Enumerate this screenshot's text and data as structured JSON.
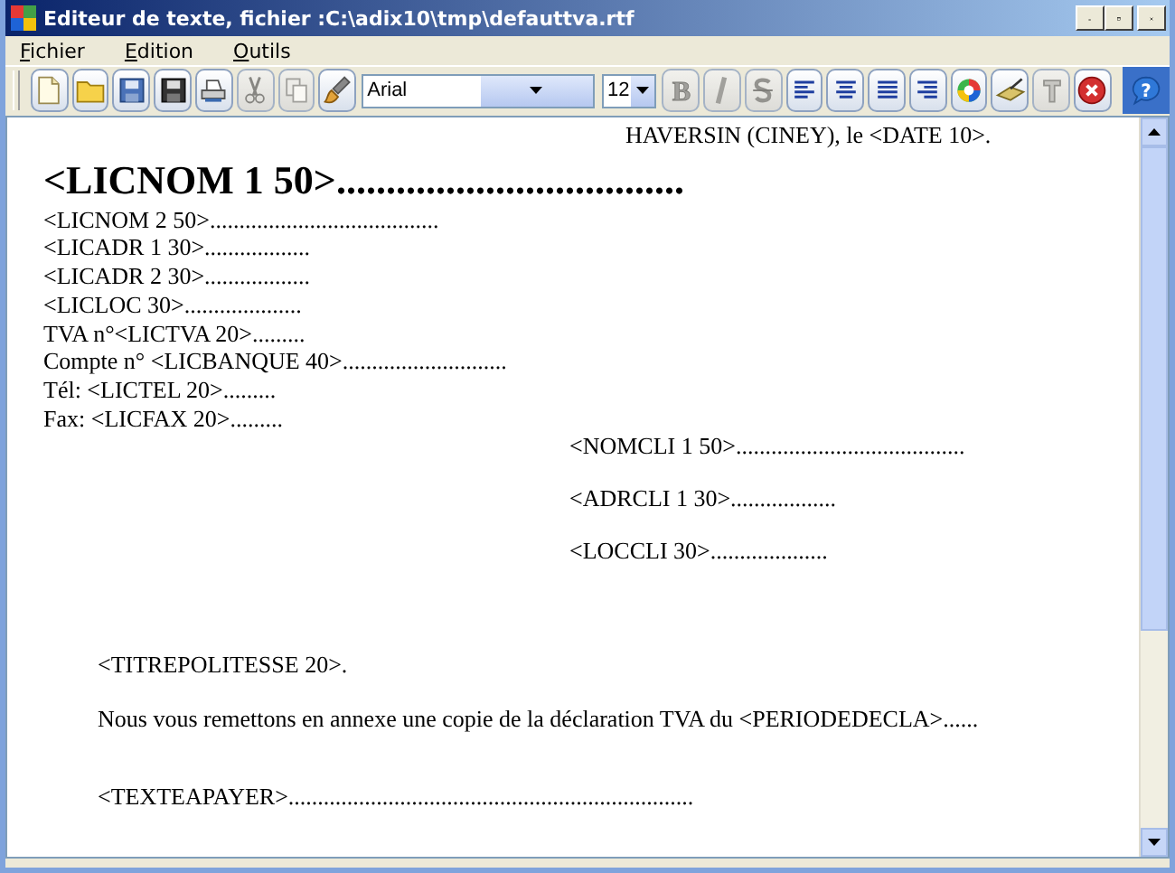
{
  "window": {
    "title": "Editeur de texte, fichier :C:\\adix10\\tmp\\defauttva.rtf"
  },
  "menu": [
    "Fichier",
    "Edition",
    "Outils"
  ],
  "toolbar": {
    "buttons": [
      {
        "kind": "new",
        "disabled": false
      },
      {
        "kind": "open",
        "disabled": false
      },
      {
        "kind": "save",
        "disabled": false
      },
      {
        "kind": "saveas",
        "disabled": false
      },
      {
        "kind": "print",
        "disabled": false
      },
      {
        "kind": "cut",
        "disabled": true
      },
      {
        "kind": "copy",
        "disabled": true
      },
      {
        "kind": "paste",
        "disabled": false
      },
      {
        "kind": "font"
      },
      {
        "kind": "size"
      },
      {
        "kind": "bold",
        "disabled": true,
        "glyph": "B"
      },
      {
        "kind": "italic",
        "disabled": true
      },
      {
        "kind": "strike",
        "disabled": true
      },
      {
        "kind": "left",
        "disabled": false
      },
      {
        "kind": "center",
        "disabled": false
      },
      {
        "kind": "justify",
        "disabled": false
      },
      {
        "kind": "right",
        "disabled": false
      },
      {
        "kind": "color",
        "disabled": false
      },
      {
        "kind": "brush",
        "disabled": false
      },
      {
        "kind": "text",
        "disabled": true
      },
      {
        "kind": "close",
        "disabled": false
      },
      {
        "kind": "help",
        "disabled": false,
        "glyph": "?"
      }
    ],
    "font": "Arial",
    "size": "12"
  },
  "document": {
    "date_line": "HAVERSIN (CINEY), le <DATE 10>.",
    "sender": [
      {
        "kind": "title",
        "text": "<LICNOM 1 50>..................................."
      },
      {
        "kind": "line",
        "text": "<LICNOM 2 50>......................................."
      },
      {
        "kind": "line",
        "text": "<LICADR 1 30>.................."
      },
      {
        "kind": "line",
        "text": "<LICADR 2 30>.................."
      },
      {
        "kind": "line",
        "text": "<LICLOC 30>...................."
      },
      {
        "kind": "line",
        "text": "TVA n°<LICTVA 20>........."
      },
      {
        "kind": "line",
        "text": "Compte n° <LICBANQUE 40>............................"
      },
      {
        "kind": "line",
        "text": "Tél: <LICTEL 20>........."
      },
      {
        "kind": "line",
        "text": "Fax: <LICFAX 20>........."
      }
    ],
    "recipient": [
      "<NOMCLI 1 50>.......................................",
      "<ADRCLI 1 30>..................",
      "<LOCCLI 30>...................."
    ],
    "body": [
      "<TITREPOLITESSE 20>.",
      "Nous vous remettons en annexe une copie de la déclaration TVA du <PERIODEDECLA>......",
      "<TEXTEAPAYER>....................................................................."
    ]
  }
}
